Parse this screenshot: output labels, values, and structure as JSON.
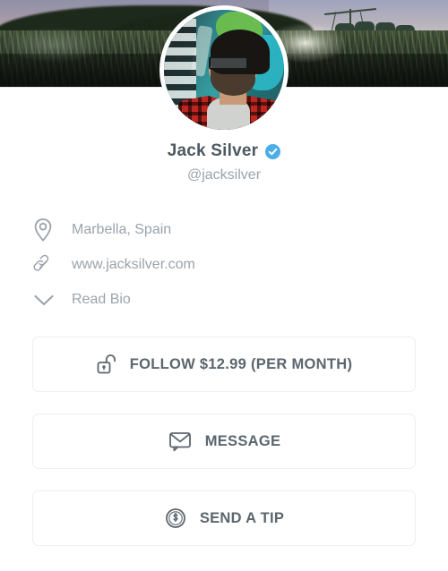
{
  "cover": {
    "alt": "dark twilight landscape with fields, trees and grain silos"
  },
  "avatar": {
    "alt": "bearded man with glasses in red plaid shirt against teal graffiti wall"
  },
  "profile": {
    "display_name": "Jack Silver",
    "handle": "@jacksilver",
    "verified_icon": "verified-check-icon",
    "verified_color": "#4cade8"
  },
  "info_rows": [
    {
      "icon": "location-pin-icon",
      "text": "Marbella, Spain"
    },
    {
      "icon": "link-chain-icon",
      "text": "www.jacksilver.com"
    },
    {
      "icon": "chevron-down-icon",
      "text": "Read Bio"
    }
  ],
  "actions": [
    {
      "icon": "unlock-padlock-icon",
      "label": "FOLLOW $12.99 (PER MONTH)"
    },
    {
      "icon": "envelope-message-icon",
      "label": "MESSAGE"
    },
    {
      "icon": "dollar-circle-icon",
      "label": "SEND A TIP"
    }
  ],
  "colors": {
    "text_primary": "#4d5962",
    "text_muted": "#9aa3ab",
    "button_label": "#5b666e",
    "button_border": "#ecf0f1",
    "background": "#ffffff"
  }
}
